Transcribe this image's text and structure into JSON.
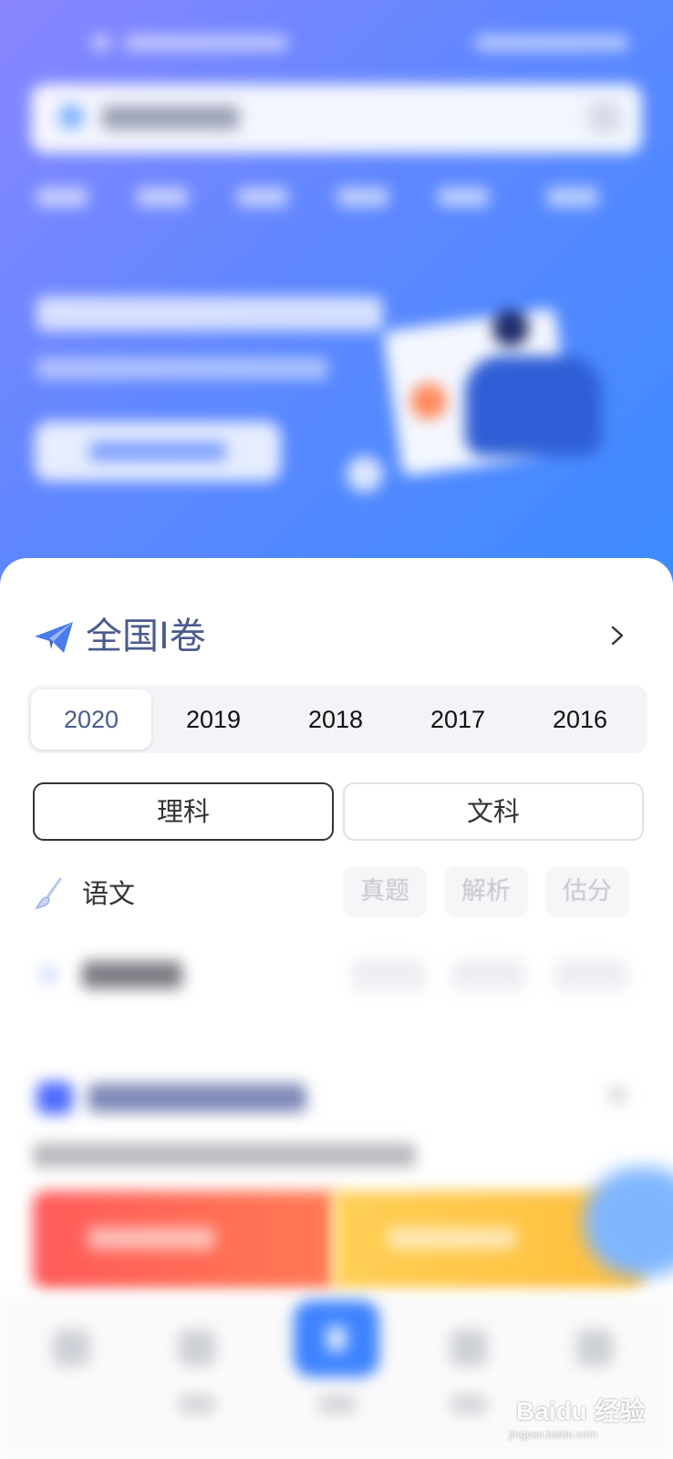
{
  "card": {
    "title": "全国I卷",
    "years": [
      "2020",
      "2019",
      "2018",
      "2017",
      "2016"
    ],
    "selected_year": "2020",
    "tracks": [
      "理科",
      "文科"
    ],
    "selected_track": "理科",
    "subject": {
      "name": "语文",
      "actions": [
        "真题",
        "解析",
        "估分"
      ]
    }
  },
  "icons": {
    "title_icon": "paper-plane-icon",
    "next_icon": "chevron-right-icon",
    "subject_icon": "brush-icon"
  },
  "colors": {
    "header_gradient_start": "#8a86ff",
    "header_gradient_end": "#3d8bff",
    "title_color": "#4a5b8c",
    "accent_blue": "#3d82ff"
  },
  "watermark": {
    "main": "Baidu 经验",
    "sub": "jingyan.baidu.com"
  }
}
